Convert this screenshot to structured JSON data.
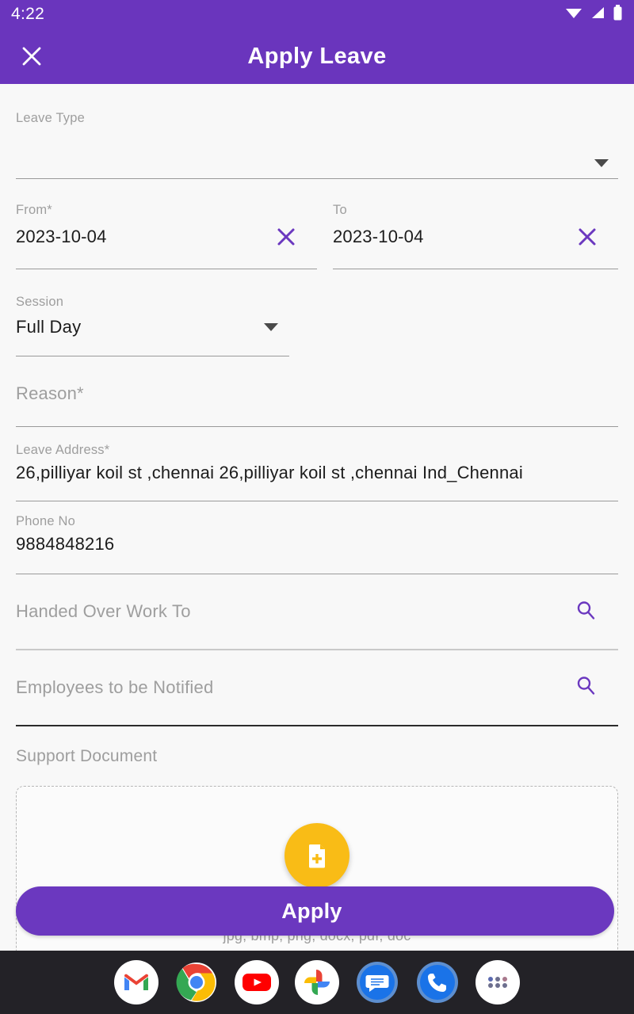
{
  "status_bar": {
    "time": "4:22",
    "icons": [
      "wifi-icon",
      "cellular-signal-icon",
      "battery-icon"
    ]
  },
  "app_bar": {
    "title": "Apply Leave",
    "close_icon": "close-icon"
  },
  "colors": {
    "primary_purple": "#6a35bd",
    "apply_button": "#6b38bf",
    "accent_yellow": "#f9bc16",
    "page_background": "#f8f8f8",
    "dock_background": "#232227",
    "label_grey": "#9e9e9e",
    "value_black": "#1c1c1c"
  },
  "form": {
    "leave_type": {
      "label": "Leave Type",
      "value": "",
      "dropdown_icon": "chevron-down-icon"
    },
    "from": {
      "label": "From*",
      "value": "2023-10-04",
      "clear_icon": "close-icon"
    },
    "to": {
      "label": "To",
      "value": "2023-10-04",
      "clear_icon": "close-icon"
    },
    "session": {
      "label": "Session",
      "value": "Full Day",
      "dropdown_icon": "chevron-down-icon",
      "options": [
        "Full Day"
      ]
    },
    "reason": {
      "placeholder": "Reason*",
      "value": ""
    },
    "leave_address": {
      "label": "Leave Address*",
      "value": "26,pilliyar koil st ,chennai 26,pilliyar koil st ,chennai Ind_Chennai"
    },
    "phone_no": {
      "label": "Phone No",
      "value": "9884848216"
    },
    "handed_over_work_to": {
      "placeholder": "Handed Over Work To",
      "value": "",
      "search_icon": "search-icon"
    },
    "employees_to_be_notified": {
      "placeholder": "Employees to be Notified",
      "value": "",
      "search_icon": "search-icon"
    },
    "support_document": {
      "label": "Support Document",
      "upload_icon": "file-add-icon",
      "hint": "jpg, bmp, png, docx, pdf, doc"
    }
  },
  "apply_button": {
    "label": "Apply"
  },
  "dock": {
    "items": [
      {
        "name": "gmail",
        "label": "Gmail"
      },
      {
        "name": "chrome",
        "label": "Chrome"
      },
      {
        "name": "youtube",
        "label": "YouTube"
      },
      {
        "name": "google-photos",
        "label": "Photos"
      },
      {
        "name": "messages",
        "label": "Messages"
      },
      {
        "name": "phone",
        "label": "Phone"
      },
      {
        "name": "app-drawer",
        "label": "All apps"
      }
    ]
  }
}
